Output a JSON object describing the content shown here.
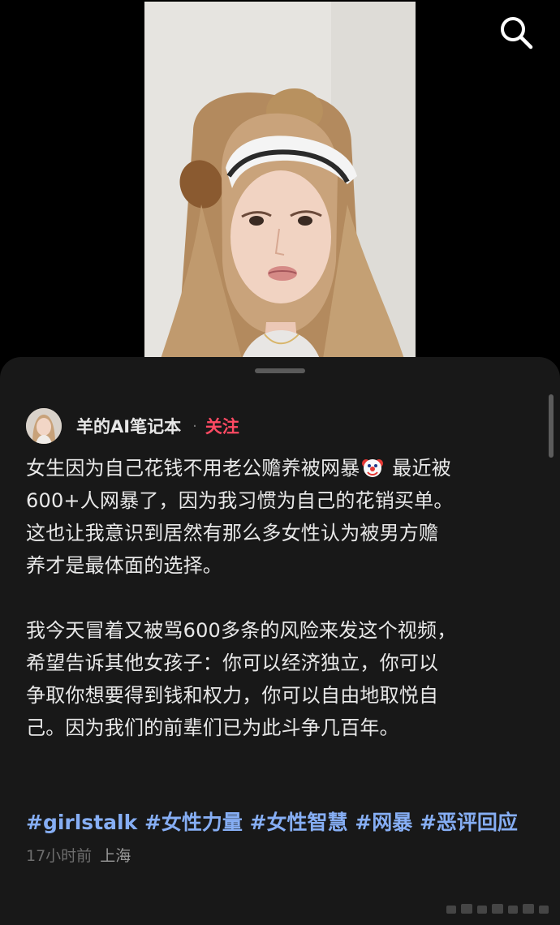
{
  "search": {
    "icon": "search-icon"
  },
  "post": {
    "author": {
      "name": "羊的AI笔记本",
      "separator": "·",
      "follow_label": "关注"
    },
    "lines_p1": [
      "女生因为自己花钱不用老公赡养被网暴",
      "最近被",
      "600+人网暴了，因为我习惯为自己的花销买单。",
      "这也让我意识到居然有那么多女性认为被男方赡",
      "养才是最体面的选择。"
    ],
    "lines_p2": [
      "我今天冒着又被骂600多条的风险来发这个视频，",
      "希望告诉其他女孩子：你可以经济独立，你可以",
      "争取你想要得到钱和权力，你可以自由地取悦自",
      "己。因为我们的前辈们已为此斗争几百年。"
    ],
    "hashtags": [
      "#girlstalk",
      "#女性力量",
      "#女性智慧",
      "#网暴",
      "#恶评回应"
    ],
    "time": "17小时前",
    "location": "上海"
  },
  "colors": {
    "sheet_bg": "#181818",
    "follow": "#ff4a63",
    "hashtag": "#86aef4",
    "meta": "#6e6e6e"
  }
}
